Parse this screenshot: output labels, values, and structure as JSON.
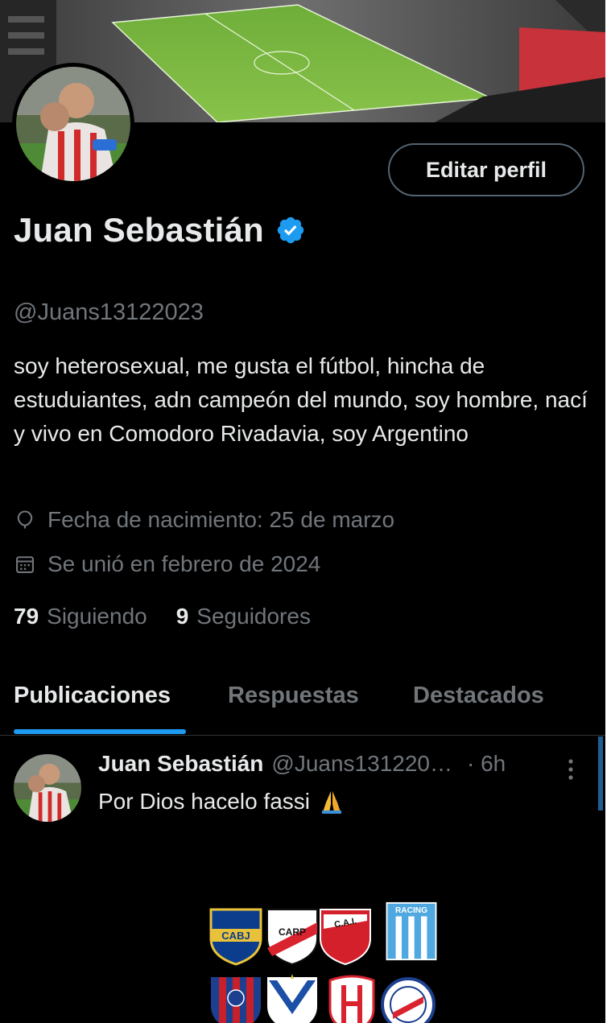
{
  "profile": {
    "display_name": "Juan Sebastián",
    "handle": "@Juans13122023",
    "bio": "soy heterosexual, me gusta el fútbol, hincha de estuduiantes, adn campeón del mundo, soy hombre, nací y vivo en Comodoro Rivadavia, soy Argentino",
    "birth_date": "Fecha de nacimiento: 25 de marzo",
    "joined": "Se unió en febrero de 2024",
    "following_count": "79",
    "following_label": "Siguiendo",
    "followers_count": "9",
    "followers_label": "Seguidores",
    "edit_button_label": "Editar perfil",
    "verified": true
  },
  "tabs": [
    {
      "label": "Publicaciones",
      "active": true
    },
    {
      "label": "Respuestas",
      "active": false
    },
    {
      "label": "Destacados",
      "active": false
    }
  ],
  "post": {
    "author": "Juan Sebastián",
    "handle": "@Juans131220…",
    "time": "· 6h",
    "text": "Por Dios hacelo fassi"
  },
  "badges": [
    {
      "name": "CABJ",
      "label": "CABJ"
    },
    {
      "name": "CARP",
      "label": "CARP"
    },
    {
      "name": "CAI",
      "label": "C.A.I."
    },
    {
      "name": "Racing",
      "label": "RACING"
    },
    {
      "name": "San Lorenzo",
      "label": ""
    },
    {
      "name": "Vélez",
      "label": ""
    },
    {
      "name": "Huracán",
      "label": ""
    },
    {
      "name": "Argentinos",
      "label": ""
    }
  ],
  "colors": {
    "background": "#000000",
    "text_primary": "#e7e9ea",
    "text_secondary": "#71767b",
    "accent": "#1d9bf0",
    "border": "#2f3336"
  },
  "icons": {
    "verified": "verified-badge-icon",
    "birth": "balloon-icon",
    "joined": "calendar-icon",
    "more": "more-vertical-icon",
    "post_emoji": "praying-hands-icon"
  }
}
